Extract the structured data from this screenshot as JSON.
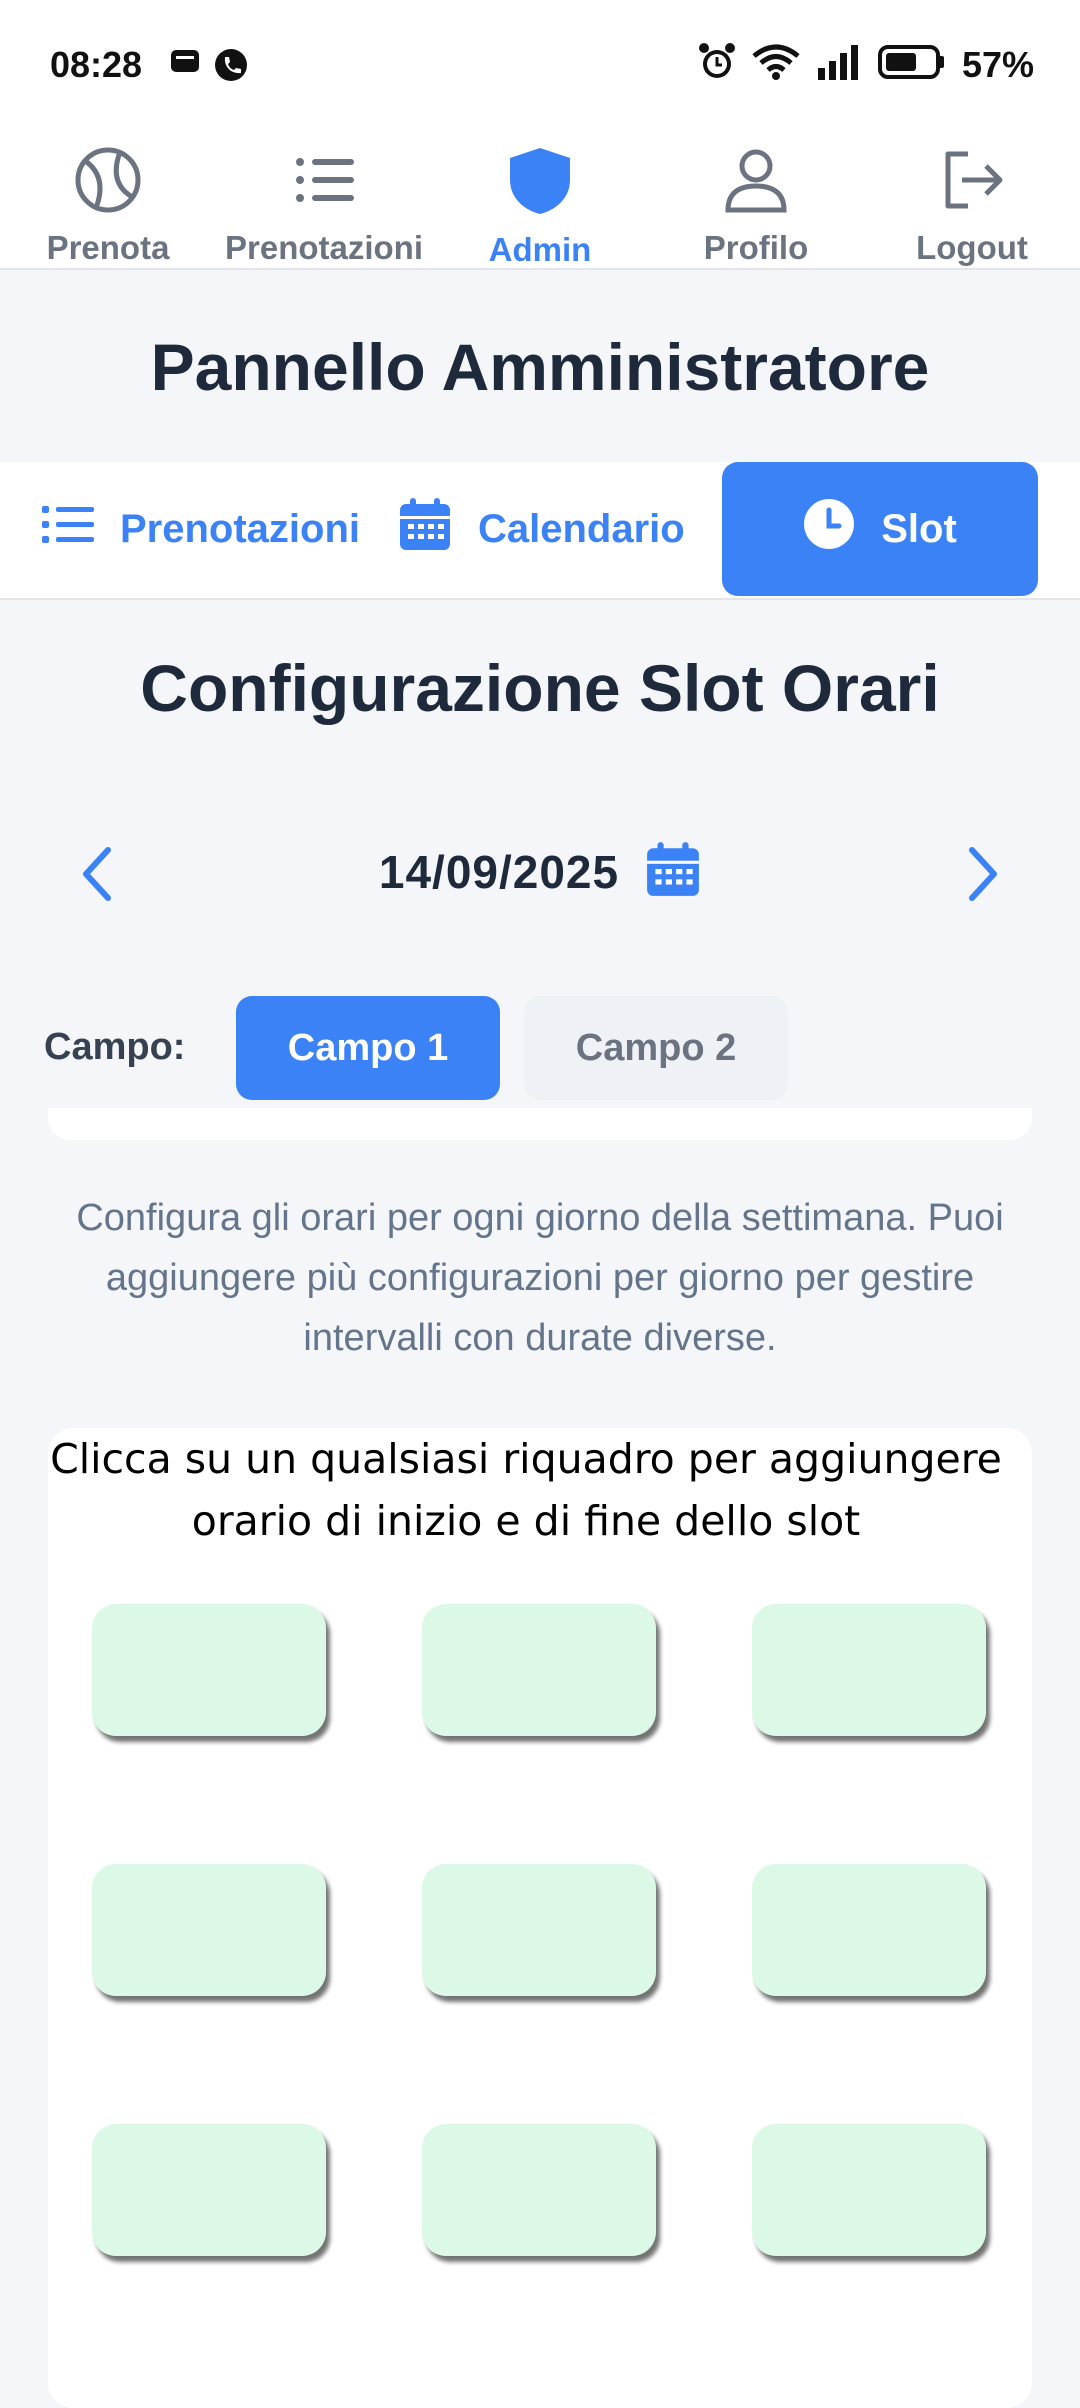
{
  "status": {
    "time": "08:28",
    "battery": "57%"
  },
  "nav": [
    {
      "label": "Prenota",
      "icon": "tennis-ball-icon"
    },
    {
      "label": "Prenotazioni",
      "icon": "list-icon"
    },
    {
      "label": "Admin",
      "icon": "shield-icon",
      "active": true
    },
    {
      "label": "Profilo",
      "icon": "user-icon"
    },
    {
      "label": "Logout",
      "icon": "logout-icon"
    }
  ],
  "page_title": "Pannello Amministratore",
  "subtabs": [
    {
      "label": "Prenotazioni",
      "icon": "list-icon"
    },
    {
      "label": "Calendario",
      "icon": "calendar-icon"
    },
    {
      "label": "Slot",
      "icon": "clock-icon",
      "active": true
    }
  ],
  "section_title": "Configurazione Slot Orari",
  "date": "14/09/2025",
  "campo": {
    "label": "Campo:",
    "options": [
      "Campo 1",
      "Campo 2"
    ],
    "selected": "Campo 1"
  },
  "description": "Configura gli orari per ogni giorno della settimana. Puoi aggiungere più configurazioni per giorno per gestire intervalli con durate diverse.",
  "overlay_hint": "Clicca su un qualsiasi riquadro per aggiungere orario di inizio e di fine dello slot",
  "colors": {
    "accent": "#3b82f6",
    "tile": "#dcf8e6",
    "text": "#1e293b"
  }
}
